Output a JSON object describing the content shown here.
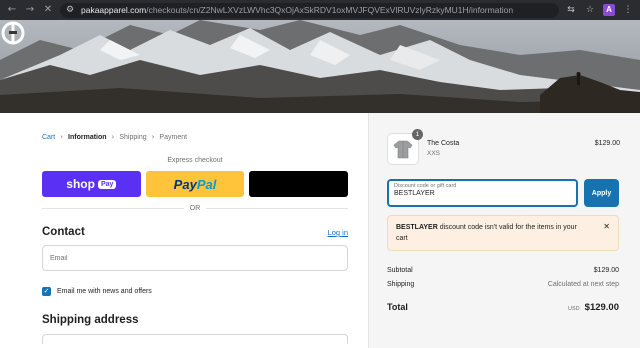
{
  "browser": {
    "url_host": "pakaapparel.com",
    "url_path": "/checkouts/cn/Z2NwLXVzLWVhc3QxOjAxSkRDV1oxMVJFQVExVlRUVzlyRzkyMU1H/information",
    "profile_letter": "A"
  },
  "breadcrumb": {
    "cart": "Cart",
    "information": "Information",
    "shipping": "Shipping",
    "payment": "Payment",
    "separator": "›"
  },
  "express": {
    "label": "Express checkout",
    "shop_label": "shop",
    "shop_badge": "Pay",
    "paypal_part1": "Pay",
    "paypal_part2": "Pal",
    "or_label": "OR"
  },
  "contact": {
    "heading": "Contact",
    "login_link": "Log in",
    "email_placeholder": "Email",
    "newsletter_label": "Email me with news and offers"
  },
  "shipping_address": {
    "heading": "Shipping address"
  },
  "cart": {
    "item_quantity": "1",
    "item_name": "The Costa",
    "item_variant": "XXS",
    "item_price": "$129.00"
  },
  "discount": {
    "label": "Discount code or gift card",
    "value": "BESTLAYER",
    "apply_label": "Apply",
    "alert_code": "BESTLAYER",
    "alert_message": " discount code isn't valid for the items in your cart"
  },
  "summary": {
    "subtotal_label": "Subtotal",
    "subtotal_value": "$129.00",
    "shipping_label": "Shipping",
    "shipping_value": "Calculated at next step",
    "total_label": "Total",
    "currency": "USD",
    "total_value": "$129.00"
  },
  "colors": {
    "accent": "#1773b0",
    "shop_pay": "#5a31f4",
    "paypal": "#ffc439",
    "alert_bg": "#fdf0e3"
  }
}
